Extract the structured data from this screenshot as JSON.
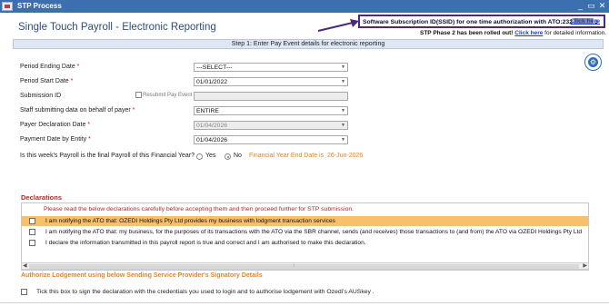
{
  "window": {
    "title": "STP Process",
    "controls": [
      "_",
      "▭",
      "✕"
    ]
  },
  "header": {
    "page_title": "Single Touch Payroll - Electronic Reporting",
    "ssid_text_prefix": "Software Subscription ID(SSID) for one time authorization with ATO:232",
    "ssid_text_suffix": "3",
    "ssid_link": "Click  here",
    "rollout_text": "STP Phase 2 has been rolled out!",
    "rollout_link": "Click  here",
    "rollout_rest": "for detailed information."
  },
  "step": {
    "label": "Step 1: Enter Pay Event details for electronic reporting"
  },
  "form": {
    "period_ending_date": {
      "label": "Period Ending Date",
      "value": "---SELECT---"
    },
    "period_start_date": {
      "label": "Period Start Date",
      "value": "01/01/2022"
    },
    "submission_id": {
      "label": "Submission ID",
      "value": "",
      "resubmit_label": "Resubmit Pay Event"
    },
    "staff_submitting": {
      "label": "Staff submitting data on behalf of payer",
      "value": "ENTIRE"
    },
    "payer_declaration_date": {
      "label": "Payer Declaration Date",
      "value": "01/04/2026"
    },
    "payment_date": {
      "label": "Payment Date by Entity",
      "value": "01/04/2026"
    },
    "final_payroll": {
      "question": "Is this week's Payroll is the final Payroll of this Financial Year?",
      "yes_label": "Yes",
      "no_label": "No",
      "selected": "No",
      "fy_end_label": "Financial Year End Date is",
      "fy_end_date": "26-Jun-2026"
    }
  },
  "declarations": {
    "title": "Declarations",
    "note": "Please read the below declarations carefully before accepting them and then proceed further for STP submission.",
    "items": [
      "I am notifying the ATO that: OZEDI Holdings Pty Ltd provides my business with lodgment transaction services",
      "I am notifying the ATO that: my business, for the purposes of its transactions with the ATO via the SBR channel, sends (and receives) those transactions to (and from) the ATO via OZEDI Holdings Pty Ltd",
      "I declare the information transmitted in this payroll report is true and correct and I am authorised to make this declaration."
    ]
  },
  "authorize": {
    "title": "Authorize Lodgement using below Sending Service Provider's Signatory Details",
    "checkbox_text": "Tick this box to sign the declaration with the credentials you used to login and to authorise lodgement with Ozedi's AUSkey ."
  },
  "colors": {
    "titlebar": "#3b6fb0",
    "accent_orange": "#e0852a",
    "declaration_red": "#c21f1f",
    "highlight_row": "#f9c06b",
    "link_blue": "#1a3bd1"
  },
  "icons": {
    "settings": "gear-icon",
    "arrow": "arrow-right-icon"
  }
}
